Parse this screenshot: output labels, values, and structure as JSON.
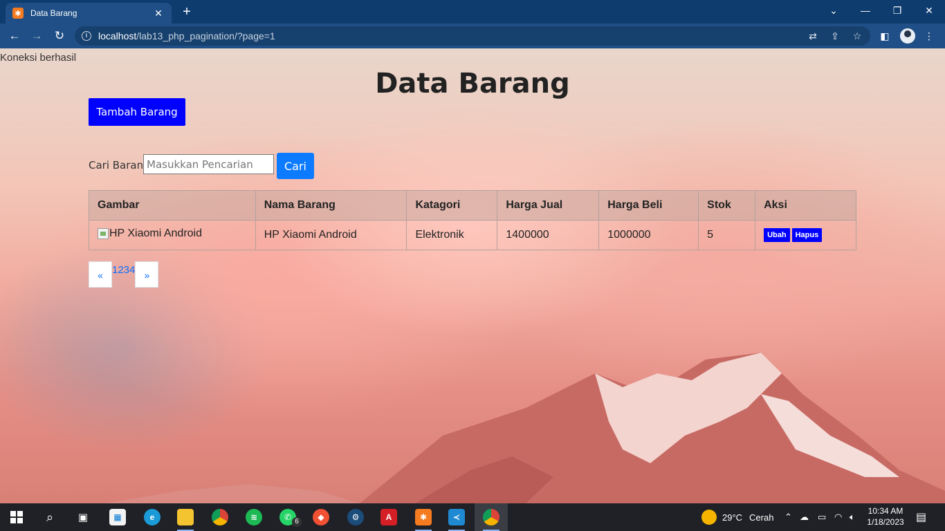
{
  "browser": {
    "tab_title": "Data Barang",
    "tab_close": "✕",
    "new_tab": "+",
    "url_host": "localhost",
    "url_path": "/lab13_php_pagination/?page=1"
  },
  "page": {
    "connection_status": "Koneksi berhasil",
    "title": "Data Barang",
    "add_button": "Tambah Barang",
    "search": {
      "label": "Cari Barang",
      "placeholder": "Masukkan Pencarian",
      "value": "",
      "button": "Cari"
    },
    "table": {
      "headers": [
        "Gambar",
        "Nama Barang",
        "Katagori",
        "Harga Jual",
        "Harga Beli",
        "Stok",
        "Aksi"
      ],
      "rows": [
        {
          "gambar_alt": "HP Xiaomi Android",
          "nama": "HP Xiaomi Android",
          "kategori": "Elektronik",
          "harga_jual": "1400000",
          "harga_beli": "1000000",
          "stok": "5",
          "edit": "Ubah",
          "delete": "Hapus"
        }
      ]
    },
    "pagination": {
      "prev": "«",
      "pages": "1234",
      "next": "»"
    }
  },
  "taskbar": {
    "weather_temp": "29°C",
    "weather_text": "Cerah",
    "time": "10:34 AM",
    "date": "1/18/2023",
    "whatsapp_badge": "6"
  }
}
